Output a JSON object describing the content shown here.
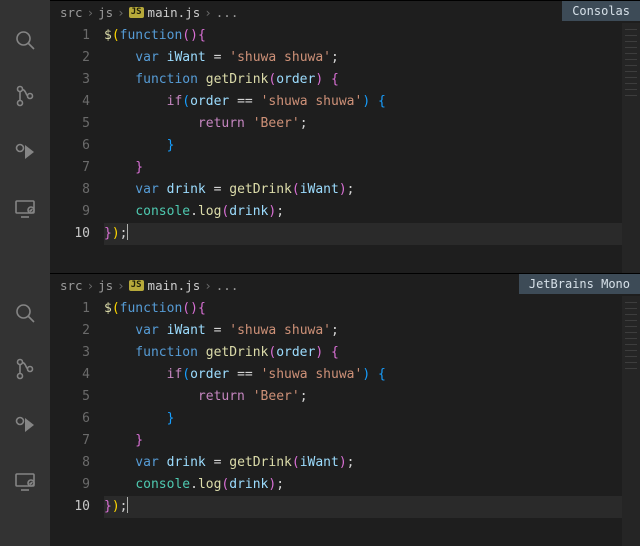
{
  "breadcrumb": {
    "seg1": "src",
    "seg2": "js",
    "file": "main.js",
    "more": "..."
  },
  "panes": [
    {
      "font_label": "Consolas",
      "cursor_line": 10
    },
    {
      "font_label": "JetBrains Mono",
      "cursor_line": 10
    }
  ],
  "line_numbers": [
    "1",
    "2",
    "3",
    "4",
    "5",
    "6",
    "7",
    "8",
    "9",
    "10"
  ],
  "code_tokens": [
    [
      [
        "fnname",
        "$"
      ],
      [
        "paren",
        "("
      ],
      [
        "kw",
        "function"
      ],
      [
        "paren2",
        "("
      ],
      [
        "paren2",
        ")"
      ],
      [
        "paren2",
        "{"
      ]
    ],
    [
      [
        "indent",
        1
      ],
      [
        "kw",
        "    var"
      ],
      [
        "punc",
        " "
      ],
      [
        "var",
        "iWant"
      ],
      [
        "punc",
        " = "
      ],
      [
        "str",
        "'shuwa shuwa'"
      ],
      [
        "punc",
        ";"
      ]
    ],
    [
      [
        "indent",
        1
      ],
      [
        "kw",
        "    function"
      ],
      [
        "punc",
        " "
      ],
      [
        "fnname",
        "getDrink"
      ],
      [
        "paren2",
        "("
      ],
      [
        "var",
        "order"
      ],
      [
        "paren2",
        ")"
      ],
      [
        "punc",
        " "
      ],
      [
        "paren2",
        "{"
      ]
    ],
    [
      [
        "indent",
        2
      ],
      [
        "ctrl",
        "        if"
      ],
      [
        "paren3",
        "("
      ],
      [
        "var",
        "order"
      ],
      [
        "punc",
        " == "
      ],
      [
        "str",
        "'shuwa shuwa'"
      ],
      [
        "paren3",
        ")"
      ],
      [
        "punc",
        " "
      ],
      [
        "paren3",
        "{"
      ]
    ],
    [
      [
        "indent",
        3
      ],
      [
        "ctrl",
        "            return"
      ],
      [
        "punc",
        " "
      ],
      [
        "str",
        "'Beer'"
      ],
      [
        "punc",
        ";"
      ]
    ],
    [
      [
        "indent",
        3
      ],
      [
        "paren3",
        "        }"
      ]
    ],
    [
      [
        "indent",
        2
      ],
      [
        "paren2",
        "    }"
      ]
    ],
    [
      [
        "indent",
        1
      ],
      [
        "kw",
        "    var"
      ],
      [
        "punc",
        " "
      ],
      [
        "var",
        "drink"
      ],
      [
        "punc",
        " = "
      ],
      [
        "fnname",
        "getDrink"
      ],
      [
        "paren2",
        "("
      ],
      [
        "var",
        "iWant"
      ],
      [
        "paren2",
        ")"
      ],
      [
        "punc",
        ";"
      ]
    ],
    [
      [
        "indent",
        1
      ],
      [
        "punc",
        "    "
      ],
      [
        "obj",
        "console"
      ],
      [
        "punc",
        "."
      ],
      [
        "fnname",
        "log"
      ],
      [
        "paren2",
        "("
      ],
      [
        "var",
        "drink"
      ],
      [
        "paren2",
        ")"
      ],
      [
        "punc",
        ";"
      ]
    ],
    [
      [
        "paren2",
        "}"
      ],
      [
        "paren",
        ")"
      ],
      [
        "punc",
        ";"
      ]
    ]
  ],
  "activity_icons": [
    "search-icon",
    "source-control-icon",
    "debug-icon",
    "remote-icon"
  ]
}
